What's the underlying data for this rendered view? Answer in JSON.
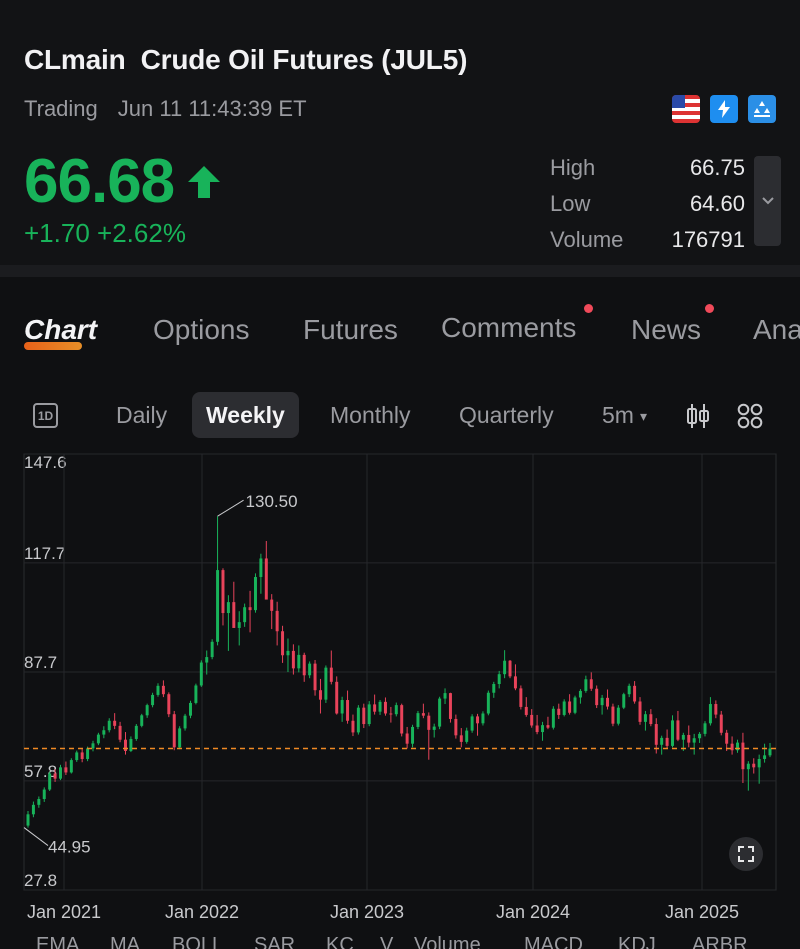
{
  "header": {
    "title": "CLmain  Crude Oil Futures (JUL5)",
    "status": "Trading",
    "timestamp": "Jun 11 11:43:39 ET",
    "badges": [
      "us-flag-icon",
      "lightning-level1-icon",
      "gold-bars-icon"
    ]
  },
  "quote": {
    "price": "66.68",
    "direction": "up",
    "change": "+1.70",
    "change_pct": "+2.62%",
    "color_up": "#18b35a",
    "stats": [
      {
        "label": "High",
        "value": "66.75"
      },
      {
        "label": "Low",
        "value": "64.60"
      },
      {
        "label": "Volume",
        "value": "176791"
      }
    ]
  },
  "tabs": [
    {
      "label": "Chart",
      "active": true
    },
    {
      "label": "Options"
    },
    {
      "label": "Futures"
    },
    {
      "label": "Comments",
      "dot": true
    },
    {
      "label": "News",
      "dot": true
    },
    {
      "label": "Ana"
    }
  ],
  "periods": {
    "oneday_icon": "1D",
    "items": [
      "Daily",
      "Weekly",
      "Monthly",
      "Quarterly"
    ],
    "active": "Weekly",
    "interval": "5m"
  },
  "indicators": [
    "EMA",
    "MA",
    "BOLL",
    "SAR",
    "KC",
    "V",
    "Volume",
    "MACD",
    "KDJ",
    "ARBR"
  ],
  "chart_data": {
    "type": "candlestick",
    "yticks": [
      "147.6",
      "117.7",
      "87.7",
      "57.8",
      "27.8"
    ],
    "xticks": [
      "Jan 2021",
      "Jan 2022",
      "Jan 2023",
      "Jan 2024",
      "Jan 2025"
    ],
    "ylim": [
      27.8,
      147.6
    ],
    "current_price": 66.68,
    "annotations": [
      {
        "label": "130.50",
        "value": 130.5,
        "kind": "high"
      },
      {
        "label": "44.95",
        "value": 44.95,
        "kind": "low"
      }
    ],
    "up_color": "#18b35a",
    "down_color": "#e8435a",
    "weekly_closes": [
      47,
      48,
      50,
      52,
      53,
      58,
      57,
      59,
      60,
      61,
      62,
      61,
      60,
      61,
      63,
      64,
      65,
      66,
      67,
      68,
      70,
      72,
      71,
      73,
      74,
      71,
      72,
      70,
      67,
      68,
      69,
      71,
      72,
      73,
      74,
      76,
      78,
      80,
      82,
      84,
      81,
      76,
      72,
      70,
      74,
      76,
      78,
      80,
      84,
      88,
      90,
      95,
      96,
      105,
      110,
      105,
      98,
      100,
      103,
      112,
      115,
      118,
      114,
      108,
      104,
      110,
      112,
      118,
      120,
      116,
      110,
      105,
      100,
      95,
      93,
      90,
      88,
      92,
      89,
      85,
      88,
      90,
      88,
      84,
      86,
      82,
      80,
      78,
      80,
      77,
      75,
      74,
      78,
      76,
      78,
      80,
      77,
      75,
      76,
      73,
      70,
      72,
      74,
      76,
      78,
      80,
      78,
      76,
      73,
      75,
      72,
      70,
      71,
      73,
      75,
      80,
      83,
      86,
      88,
      90,
      88,
      85,
      82,
      80,
      78,
      76,
      74,
      73,
      75,
      78,
      80,
      81,
      83,
      80,
      78,
      80,
      82,
      84,
      86,
      88,
      85,
      82,
      80,
      78,
      79,
      80,
      82,
      84,
      86,
      84,
      82,
      80,
      78,
      77,
      75,
      74,
      72,
      71,
      70,
      72,
      74,
      73,
      71,
      70,
      72,
      71,
      73,
      75,
      78,
      76,
      74,
      72,
      70,
      66,
      62,
      60,
      58,
      61,
      63,
      62,
      64,
      66.68
    ],
    "ohlc": [
      [
        45.5,
        49.5,
        44.95,
        48.6
      ],
      [
        48.6,
        52.1,
        47.8,
        51.2
      ],
      [
        51.2,
        53.5,
        50.4,
        52.8
      ],
      [
        52.8,
        56.0,
        52.0,
        55.4
      ],
      [
        55.4,
        60.3,
        55.0,
        59.8
      ],
      [
        59.8,
        61.0,
        57.5,
        58.4
      ],
      [
        58.4,
        62.2,
        58.0,
        61.5
      ],
      [
        61.5,
        63.1,
        59.4,
        60.1
      ],
      [
        60.1,
        64.0,
        59.8,
        63.5
      ],
      [
        63.5,
        66.1,
        63.0,
        65.6
      ],
      [
        65.6,
        66.5,
        62.9,
        63.8
      ],
      [
        63.8,
        67.2,
        63.2,
        66.7
      ],
      [
        66.7,
        68.8,
        65.9,
        68.1
      ],
      [
        68.1,
        71.0,
        67.6,
        70.5
      ],
      [
        70.5,
        72.8,
        69.5,
        71.7
      ],
      [
        71.7,
        75.0,
        71.1,
        74.3
      ],
      [
        74.3,
        76.4,
        72.0,
        72.9
      ],
      [
        72.9,
        74.0,
        68.4,
        69.1
      ],
      [
        69.1,
        71.2,
        65.0,
        66.0
      ],
      [
        66.0,
        70.0,
        65.7,
        69.3
      ],
      [
        69.3,
        73.4,
        68.8,
        72.9
      ],
      [
        72.9,
        76.2,
        72.5,
        75.8
      ],
      [
        75.8,
        79.0,
        75.1,
        78.6
      ],
      [
        78.6,
        82.0,
        78.0,
        81.4
      ],
      [
        81.4,
        84.6,
        80.9,
        83.9
      ],
      [
        83.9,
        85.4,
        80.8,
        81.6
      ],
      [
        81.6,
        82.1,
        75.3,
        76.1
      ],
      [
        76.1,
        77.0,
        66.2,
        67.0
      ],
      [
        67.0,
        72.8,
        66.5,
        72.2
      ],
      [
        72.2,
        76.2,
        71.6,
        75.7
      ],
      [
        75.7,
        79.8,
        75.0,
        79.2
      ],
      [
        79.2,
        84.5,
        78.8,
        84.0
      ],
      [
        84.0,
        90.9,
        83.6,
        90.3
      ],
      [
        90.3,
        93.6,
        87.0,
        91.8
      ],
      [
        91.8,
        96.7,
        91.2,
        96.0
      ],
      [
        96.0,
        130.5,
        95.0,
        115.7
      ],
      [
        115.7,
        116.2,
        100.5,
        103.9
      ],
      [
        103.9,
        108.8,
        93.5,
        106.9
      ],
      [
        106.9,
        112.5,
        102.0,
        99.8
      ],
      [
        99.8,
        104.4,
        95.0,
        101.4
      ],
      [
        101.4,
        106.5,
        100.1,
        105.5
      ],
      [
        105.5,
        110.0,
        98.6,
        104.7
      ],
      [
        104.7,
        114.8,
        104.0,
        113.8
      ],
      [
        113.8,
        120.2,
        109.2,
        118.9
      ],
      [
        118.9,
        123.7,
        115.5,
        107.6
      ],
      [
        107.6,
        109.1,
        99.5,
        104.5
      ],
      [
        104.5,
        107.0,
        95.0,
        98.9
      ],
      [
        98.9,
        100.4,
        90.2,
        92.3
      ],
      [
        92.3,
        96.9,
        87.7,
        93.5
      ],
      [
        93.5,
        95.3,
        87.0,
        88.7
      ],
      [
        88.7,
        95.0,
        87.6,
        92.4
      ],
      [
        92.4,
        93.0,
        85.0,
        86.8
      ],
      [
        86.8,
        90.6,
        86.0,
        90.0
      ],
      [
        90.0,
        91.0,
        81.2,
        82.7
      ],
      [
        82.7,
        85.8,
        76.3,
        80.1
      ],
      [
        80.1,
        89.5,
        79.2,
        88.9
      ],
      [
        88.9,
        93.6,
        84.3,
        85.0
      ],
      [
        85.0,
        86.5,
        76.0,
        76.3
      ],
      [
        76.3,
        80.9,
        74.0,
        80.0
      ],
      [
        80.0,
        82.6,
        73.5,
        74.3
      ],
      [
        74.3,
        76.0,
        70.1,
        71.1
      ],
      [
        71.1,
        78.6,
        70.5,
        77.9
      ],
      [
        77.9,
        79.0,
        72.3,
        73.4
      ],
      [
        73.4,
        79.7,
        72.8,
        78.8
      ],
      [
        78.8,
        81.5,
        76.0,
        76.8
      ],
      [
        76.8,
        80.0,
        75.9,
        79.5
      ],
      [
        79.5,
        80.7,
        75.7,
        76.3
      ],
      [
        76.3,
        78.1,
        73.8,
        76.1
      ],
      [
        76.1,
        79.3,
        75.5,
        78.6
      ],
      [
        78.6,
        79.0,
        70.0,
        70.8
      ],
      [
        70.8,
        72.6,
        66.7,
        68.0
      ],
      [
        68.0,
        73.2,
        67.0,
        72.6
      ],
      [
        72.6,
        77.0,
        72.0,
        76.4
      ],
      [
        76.4,
        79.0,
        75.0,
        75.7
      ],
      [
        75.7,
        76.6,
        63.6,
        71.8
      ],
      [
        71.8,
        73.5,
        69.7,
        72.7
      ],
      [
        72.7,
        80.9,
        72.0,
        80.4
      ],
      [
        80.4,
        83.2,
        78.9,
        81.9
      ],
      [
        81.9,
        82.0,
        73.8,
        74.8
      ],
      [
        74.8,
        76.0,
        69.4,
        70.3
      ],
      [
        70.3,
        72.3,
        67.0,
        68.5
      ],
      [
        68.5,
        72.4,
        68.0,
        71.6
      ],
      [
        71.6,
        76.1,
        71.0,
        75.5
      ],
      [
        75.5,
        76.2,
        70.2,
        73.6
      ],
      [
        73.6,
        76.9,
        73.0,
        76.3
      ],
      [
        76.3,
        82.6,
        75.8,
        82.0
      ],
      [
        82.0,
        85.0,
        80.6,
        84.4
      ],
      [
        84.4,
        88.0,
        83.2,
        87.1
      ],
      [
        87.1,
        93.7,
        86.0,
        90.8
      ],
      [
        90.8,
        91.0,
        86.0,
        86.5
      ],
      [
        86.5,
        89.8,
        82.7,
        83.2
      ],
      [
        83.2,
        84.0,
        77.4,
        78.1
      ],
      [
        78.1,
        80.8,
        75.4,
        75.9
      ],
      [
        75.9,
        77.5,
        72.4,
        73.0
      ],
      [
        73.0,
        75.9,
        70.6,
        71.2
      ],
      [
        71.2,
        74.0,
        68.8,
        73.1
      ],
      [
        73.1,
        75.4,
        72.0,
        72.4
      ],
      [
        72.4,
        78.3,
        71.9,
        77.6
      ],
      [
        77.6,
        79.0,
        74.8,
        75.9
      ],
      [
        75.9,
        80.2,
        75.5,
        79.6
      ],
      [
        79.6,
        81.6,
        76.0,
        76.5
      ],
      [
        76.5,
        81.2,
        76.1,
        80.7
      ],
      [
        80.7,
        83.0,
        79.0,
        82.5
      ],
      [
        82.5,
        86.7,
        82.0,
        85.7
      ],
      [
        85.7,
        87.6,
        82.5,
        83.1
      ],
      [
        83.1,
        84.0,
        77.8,
        78.6
      ],
      [
        78.6,
        81.4,
        76.0,
        80.6
      ],
      [
        80.6,
        82.9,
        77.4,
        78.2
      ],
      [
        78.2,
        79.0,
        72.8,
        73.5
      ],
      [
        73.5,
        78.6,
        73.0,
        77.9
      ],
      [
        77.9,
        82.0,
        77.5,
        81.6
      ],
      [
        81.6,
        84.5,
        80.8,
        83.9
      ],
      [
        83.9,
        85.2,
        79.0,
        79.6
      ],
      [
        79.6,
        80.8,
        73.2,
        74.0
      ],
      [
        74.0,
        77.0,
        71.6,
        76.1
      ],
      [
        76.1,
        77.5,
        72.8,
        73.4
      ],
      [
        73.4,
        75.0,
        65.3,
        67.7
      ],
      [
        67.7,
        70.2,
        65.0,
        69.6
      ],
      [
        69.6,
        71.9,
        66.8,
        67.4
      ],
      [
        67.4,
        75.8,
        67.0,
        74.4
      ],
      [
        74.4,
        77.0,
        68.7,
        69.1
      ],
      [
        69.1,
        71.0,
        66.0,
        70.4
      ],
      [
        70.4,
        73.0,
        67.0,
        68.3
      ],
      [
        68.3,
        70.7,
        65.0,
        69.5
      ],
      [
        69.5,
        71.2,
        68.2,
        70.7
      ],
      [
        70.7,
        74.2,
        70.0,
        73.6
      ],
      [
        73.6,
        80.8,
        73.0,
        78.9
      ],
      [
        78.9,
        79.9,
        75.0,
        76.0
      ],
      [
        76.0,
        77.0,
        70.3,
        71.0
      ],
      [
        71.0,
        71.8,
        66.0,
        68.0
      ],
      [
        68.0,
        70.0,
        65.0,
        66.2
      ],
      [
        66.2,
        69.1,
        65.5,
        68.3
      ],
      [
        68.3,
        71.0,
        57.2,
        61.0
      ],
      [
        61.0,
        63.2,
        55.1,
        62.5
      ],
      [
        62.5,
        64.0,
        59.8,
        61.5
      ],
      [
        61.5,
        65.0,
        57.0,
        63.8
      ],
      [
        63.8,
        68.0,
        62.8,
        64.8
      ],
      [
        64.8,
        68.2,
        64.3,
        66.68
      ]
    ]
  }
}
